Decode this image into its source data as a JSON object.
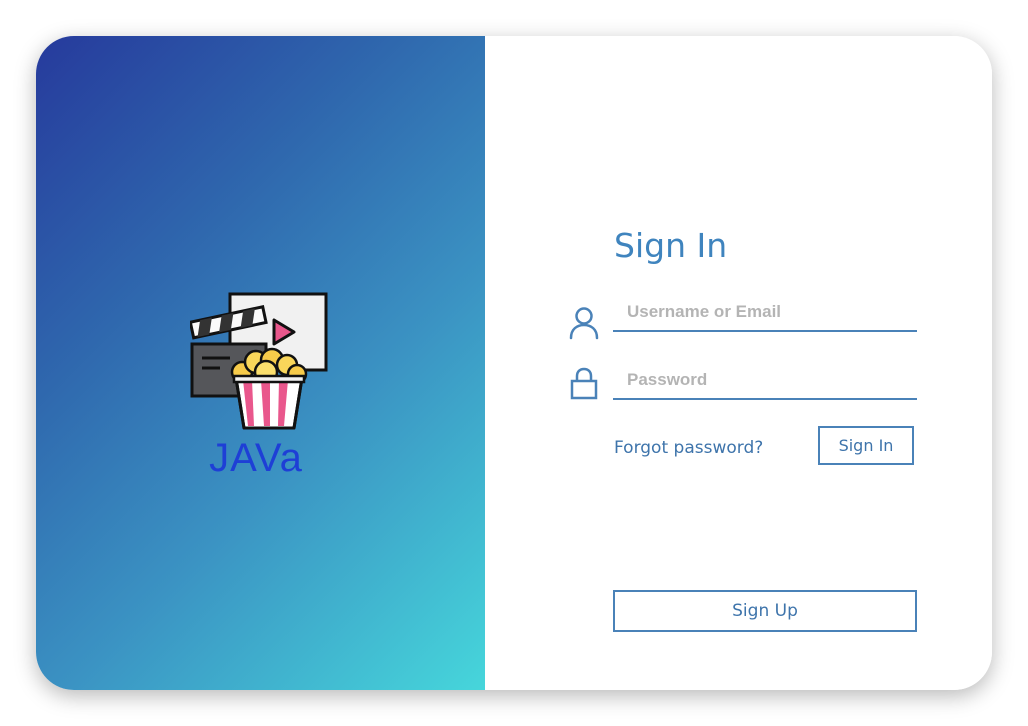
{
  "brand": {
    "name": "JAVa",
    "logo_icon": "movie-clapperboard-popcorn-icon"
  },
  "colors": {
    "gradient_start": "#263a9c",
    "gradient_end": "#46d6db",
    "accent": "#3f84be",
    "brand_text": "#1e3fd6"
  },
  "signin": {
    "title": "Sign In",
    "username_placeholder": "Username or Email",
    "username_value": "",
    "username_icon": "user-icon",
    "password_placeholder": "Password",
    "password_value": "",
    "password_icon": "lock-icon",
    "forgot_label": "Forgot password?",
    "signin_label": "Sign In",
    "signup_label": "Sign Up"
  }
}
